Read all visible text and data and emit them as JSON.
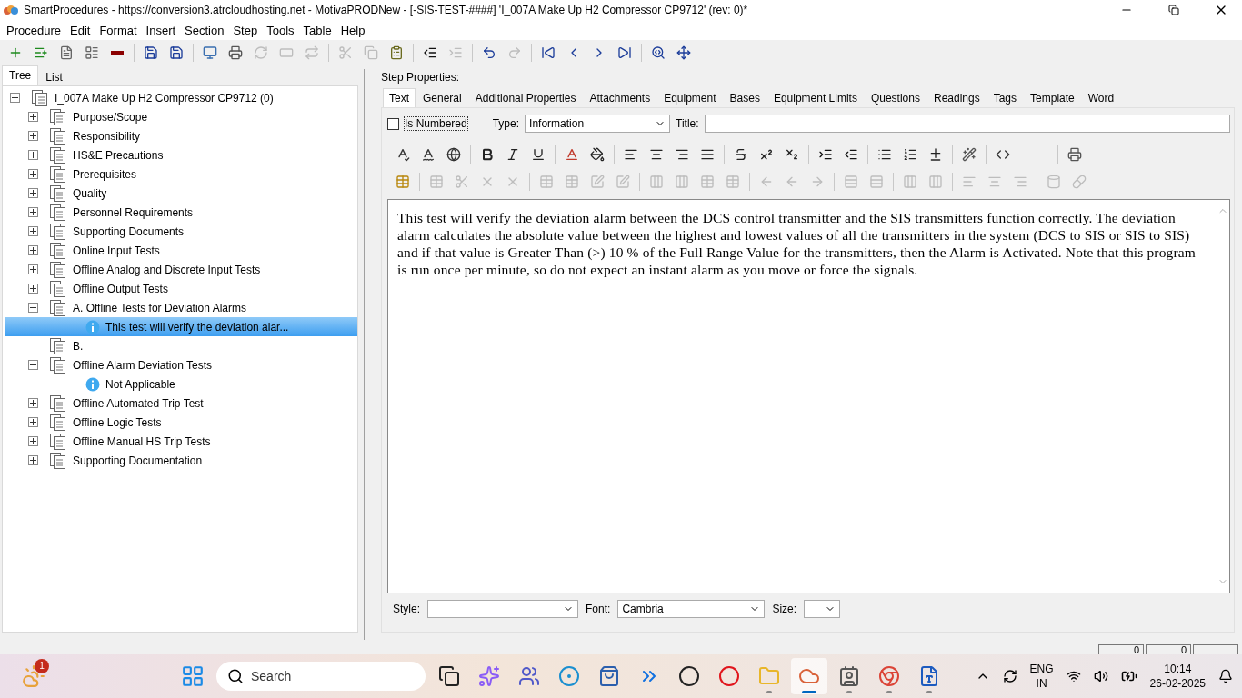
{
  "window": {
    "title": "SmartProcedures - https://conversion3.atrcloudhosting.net - MotivaPRODNew - [-SIS-TEST-####] 'I_007A Make Up H2 Compressor CP9712' (rev: 0)*"
  },
  "menu": [
    "Procedure",
    "Edit",
    "Format",
    "Insert",
    "Section",
    "Step",
    "Tools",
    "Table",
    "Help"
  ],
  "toolbar": [
    {
      "kind": "add",
      "disabled": false
    },
    {
      "kind": "add-child",
      "disabled": false
    },
    {
      "kind": "document",
      "disabled": false
    },
    {
      "kind": "form",
      "disabled": false
    },
    {
      "kind": "remove",
      "disabled": false
    },
    {
      "kind": "sep"
    },
    {
      "kind": "save-all",
      "disabled": false
    },
    {
      "kind": "save",
      "disabled": false
    },
    {
      "kind": "sep"
    },
    {
      "kind": "monitor",
      "disabled": false
    },
    {
      "kind": "print",
      "disabled": false
    },
    {
      "kind": "refresh",
      "disabled": true
    },
    {
      "kind": "frame",
      "disabled": true
    },
    {
      "kind": "redo-step",
      "disabled": true
    },
    {
      "kind": "sep"
    },
    {
      "kind": "cut",
      "disabled": true
    },
    {
      "kind": "copy",
      "disabled": true
    },
    {
      "kind": "paste",
      "disabled": false
    },
    {
      "kind": "sep"
    },
    {
      "kind": "outdent",
      "disabled": false
    },
    {
      "kind": "indent",
      "disabled": true
    },
    {
      "kind": "sep"
    },
    {
      "kind": "undo",
      "disabled": false
    },
    {
      "kind": "redo",
      "disabled": true
    },
    {
      "kind": "sep"
    },
    {
      "kind": "first",
      "disabled": false
    },
    {
      "kind": "previous",
      "disabled": false
    },
    {
      "kind": "next",
      "disabled": false
    },
    {
      "kind": "last",
      "disabled": false
    },
    {
      "kind": "sep"
    },
    {
      "kind": "find",
      "disabled": false
    },
    {
      "kind": "move",
      "disabled": false
    }
  ],
  "left_tabs": [
    {
      "label": "Tree",
      "selected": true
    },
    {
      "label": "List",
      "selected": false
    }
  ],
  "tree": [
    {
      "label": "I_007A Make Up H2 Compressor CP9712 (0)",
      "kind": "section",
      "expanded": true,
      "selected": false,
      "children": [
        {
          "label": "Purpose/Scope",
          "kind": "section",
          "expanded": false,
          "selected": false
        },
        {
          "label": "Responsibility",
          "kind": "section",
          "expanded": false,
          "selected": false
        },
        {
          "label": "HS&E Precautions",
          "kind": "section",
          "expanded": false,
          "selected": false
        },
        {
          "label": "Prerequisites",
          "kind": "section",
          "expanded": false,
          "selected": false
        },
        {
          "label": "Quality",
          "kind": "section",
          "expanded": false,
          "selected": false
        },
        {
          "label": "Personnel Requirements",
          "kind": "section",
          "expanded": false,
          "selected": false
        },
        {
          "label": "Supporting Documents",
          "kind": "section",
          "expanded": false,
          "selected": false
        },
        {
          "label": "Online Input Tests",
          "kind": "section",
          "expanded": false,
          "selected": false
        },
        {
          "label": "Offline Analog and Discrete Input Tests",
          "kind": "section",
          "expanded": false,
          "selected": false
        },
        {
          "label": "Offline Output Tests",
          "kind": "section",
          "expanded": false,
          "selected": false
        },
        {
          "label": "A. Offline Tests for Deviation Alarms",
          "kind": "section",
          "expanded": true,
          "selected": false,
          "children": [
            {
              "label": "This test will verify the deviation alar...",
              "kind": "info",
              "selected": true
            }
          ]
        },
        {
          "label": "B.",
          "kind": "section",
          "selected": false
        },
        {
          "label": "Offline Alarm Deviation Tests",
          "kind": "section",
          "expanded": true,
          "selected": false,
          "children": [
            {
              "label": "Not Applicable",
              "kind": "info",
              "selected": false
            }
          ]
        },
        {
          "label": "Offline Automated Trip Test",
          "kind": "section",
          "expanded": false,
          "selected": false
        },
        {
          "label": "Offline Logic Tests",
          "kind": "section",
          "expanded": false,
          "selected": false
        },
        {
          "label": "Offline Manual HS Trip Tests",
          "kind": "section",
          "expanded": false,
          "selected": false
        },
        {
          "label": "Supporting Documentation",
          "kind": "section",
          "expanded": false,
          "selected": false
        }
      ]
    }
  ],
  "step_properties": {
    "heading": "Step Properties:",
    "tabs": [
      {
        "label": "Text",
        "selected": true
      },
      {
        "label": "General",
        "selected": false
      },
      {
        "label": "Additional Properties",
        "selected": false
      },
      {
        "label": "Attachments",
        "selected": false
      },
      {
        "label": "Equipment",
        "selected": false
      },
      {
        "label": "Bases",
        "selected": false
      },
      {
        "label": "Equipment Limits",
        "selected": false
      },
      {
        "label": "Questions",
        "selected": false
      },
      {
        "label": "Readings",
        "selected": false
      },
      {
        "label": "Tags",
        "selected": false
      },
      {
        "label": "Template",
        "selected": false
      },
      {
        "label": "Word",
        "selected": false
      }
    ],
    "is_numbered": {
      "label": "Is Numbered",
      "checked": false
    },
    "type": {
      "label": "Type:",
      "value": "Information"
    },
    "title": {
      "label": "Title:"
    },
    "format_row_1": [
      {
        "kind": "spell",
        "disabled": false
      },
      {
        "kind": "spell-auto",
        "disabled": false
      },
      {
        "kind": "globe",
        "disabled": false
      },
      {
        "kind": "sep"
      },
      {
        "kind": "bold",
        "disabled": false
      },
      {
        "kind": "italic",
        "disabled": false
      },
      {
        "kind": "underline",
        "disabled": false
      },
      {
        "kind": "sep"
      },
      {
        "kind": "font-color",
        "disabled": false
      },
      {
        "kind": "fill",
        "disabled": false
      },
      {
        "kind": "sep"
      },
      {
        "kind": "align-left",
        "disabled": false
      },
      {
        "kind": "align-center",
        "disabled": false
      },
      {
        "kind": "align-right",
        "disabled": false
      },
      {
        "kind": "justify",
        "disabled": false
      },
      {
        "kind": "sep"
      },
      {
        "kind": "strike",
        "disabled": false
      },
      {
        "kind": "superscript",
        "disabled": false
      },
      {
        "kind": "subscript",
        "disabled": false
      },
      {
        "kind": "sep"
      },
      {
        "kind": "indent",
        "disabled": false
      },
      {
        "kind": "outdent",
        "disabled": false
      },
      {
        "kind": "sep"
      },
      {
        "kind": "bullets",
        "disabled": false
      },
      {
        "kind": "numbering",
        "disabled": false
      },
      {
        "kind": "plus-minus",
        "disabled": false
      },
      {
        "kind": "sep"
      },
      {
        "kind": "wand",
        "disabled": false
      },
      {
        "kind": "sep"
      },
      {
        "kind": "code",
        "disabled": false
      },
      {
        "kind": "gap"
      },
      {
        "kind": "sep"
      },
      {
        "kind": "print",
        "disabled": false
      }
    ],
    "format_row_2": [
      {
        "kind": "table-insert",
        "disabled": false
      },
      {
        "kind": "sep"
      },
      {
        "kind": "table",
        "disabled": true
      },
      {
        "kind": "cut",
        "disabled": true
      },
      {
        "kind": "close",
        "disabled": true
      },
      {
        "kind": "close",
        "disabled": true
      },
      {
        "kind": "sep"
      },
      {
        "kind": "table",
        "disabled": true
      },
      {
        "kind": "table",
        "disabled": true
      },
      {
        "kind": "edit",
        "disabled": true
      },
      {
        "kind": "edit",
        "disabled": true
      },
      {
        "kind": "sep"
      },
      {
        "kind": "columns",
        "disabled": true
      },
      {
        "kind": "columns",
        "disabled": true
      },
      {
        "kind": "table",
        "disabled": true
      },
      {
        "kind": "table",
        "disabled": true
      },
      {
        "kind": "sep"
      },
      {
        "kind": "arrow-left",
        "disabled": true
      },
      {
        "kind": "arrow-left",
        "disabled": true
      },
      {
        "kind": "arrow-right",
        "disabled": true
      },
      {
        "kind": "sep"
      },
      {
        "kind": "rows",
        "disabled": true
      },
      {
        "kind": "rows",
        "disabled": true
      },
      {
        "kind": "sep"
      },
      {
        "kind": "columns",
        "disabled": true
      },
      {
        "kind": "columns",
        "disabled": true
      },
      {
        "kind": "sep"
      },
      {
        "kind": "align-left",
        "disabled": true
      },
      {
        "kind": "align-center",
        "disabled": true
      },
      {
        "kind": "align-right",
        "disabled": true
      },
      {
        "kind": "sep"
      },
      {
        "kind": "cylinder",
        "disabled": true
      },
      {
        "kind": "pill",
        "disabled": true
      }
    ],
    "body": "This test will verify the deviation alarm between the DCS control transmitter and the SIS transmitters function correctly. The deviation alarm calculates the absolute value between the highest and lowest values of all the transmitters in the system (DCS to SIS or SIS to SIS) and if that value is Greater Than (>) 10 % of the Full Range Value for the transmitters, then the Alarm is Activated. Note that this program is run once per minute, so do not expect an instant alarm as you move or force the signals.",
    "style": {
      "label": "Style:"
    },
    "font": {
      "label": "Font:",
      "value": "Cambria"
    },
    "size": {
      "label": "Size:"
    }
  },
  "status_bar": [
    "0",
    "0"
  ],
  "taskbar": {
    "weather_badge": "1",
    "search": {
      "placeholder": "Search"
    },
    "apps": [
      {
        "kind": "windows",
        "open": false,
        "active": false
      },
      {
        "kind": "task-view",
        "open": false,
        "active": false
      },
      {
        "kind": "copilot",
        "open": false,
        "active": false
      },
      {
        "kind": "teams",
        "open": false,
        "active": false
      },
      {
        "kind": "edge",
        "open": false,
        "active": false
      },
      {
        "kind": "store",
        "open": false,
        "active": false
      },
      {
        "kind": "automate",
        "open": false,
        "active": false
      },
      {
        "kind": "dell",
        "open": false,
        "active": false
      },
      {
        "kind": "opera",
        "open": false,
        "active": false
      },
      {
        "kind": "folder",
        "open": true,
        "active": false
      },
      {
        "kind": "app",
        "open": true,
        "active": true
      },
      {
        "kind": "contact",
        "open": true,
        "active": false
      },
      {
        "kind": "chrome",
        "open": true,
        "active": false
      },
      {
        "kind": "word",
        "open": true,
        "active": false
      }
    ],
    "language": [
      "ENG",
      "IN"
    ],
    "time": "10:14",
    "date": "26-02-2025"
  }
}
